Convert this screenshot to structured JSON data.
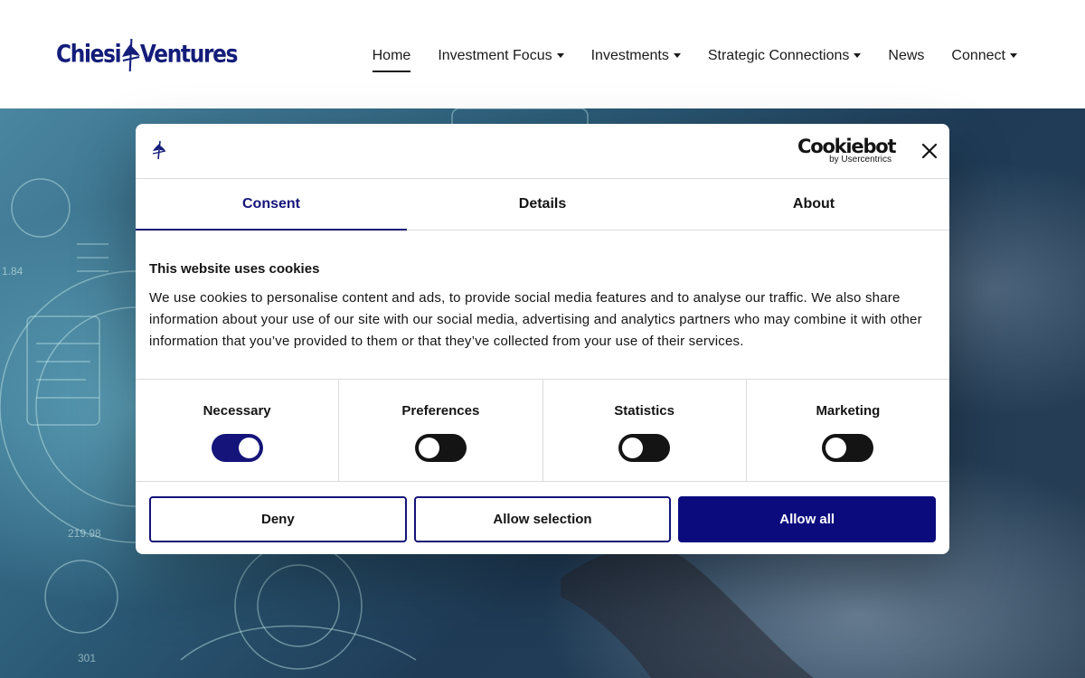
{
  "header": {
    "logo": {
      "left": "Chiesi",
      "right": "Ventures",
      "mark_icon": "chiesi-sailboat-logo"
    },
    "nav": [
      {
        "label": "Home",
        "active": true,
        "dropdown": false
      },
      {
        "label": "Investment Focus",
        "active": false,
        "dropdown": true
      },
      {
        "label": "Investments",
        "active": false,
        "dropdown": true
      },
      {
        "label": "Strategic Connections",
        "active": false,
        "dropdown": true
      },
      {
        "label": "News",
        "active": false,
        "dropdown": false
      },
      {
        "label": "Connect",
        "active": false,
        "dropdown": true
      }
    ]
  },
  "hero": {
    "overlay_numbers": [
      "1.84",
      "219.98",
      "301"
    ]
  },
  "cookie_dialog": {
    "brand": {
      "name": "Cookiebot",
      "sub": "by Usercentrics"
    },
    "close_icon": "close-x",
    "tabs": [
      {
        "label": "Consent",
        "active": true
      },
      {
        "label": "Details",
        "active": false
      },
      {
        "label": "About",
        "active": false
      }
    ],
    "title": "This website uses cookies",
    "body": "We use cookies to personalise content and ads, to provide social media features and to analyse our traffic. We also share information about your use of our site with our social media, advertising and analytics partners who may combine it with other information that you’ve provided to them or that they’ve collected from your use of their services.",
    "toggles": [
      {
        "label": "Necessary",
        "on": true
      },
      {
        "label": "Preferences",
        "on": false
      },
      {
        "label": "Statistics",
        "on": false
      },
      {
        "label": "Marketing",
        "on": false
      }
    ],
    "buttons": {
      "deny": "Deny",
      "allow_selection": "Allow selection",
      "allow_all": "Allow all"
    }
  },
  "colors": {
    "brand_navy": "#14147a",
    "button_navy": "#0b0b7e",
    "text": "#141414"
  }
}
